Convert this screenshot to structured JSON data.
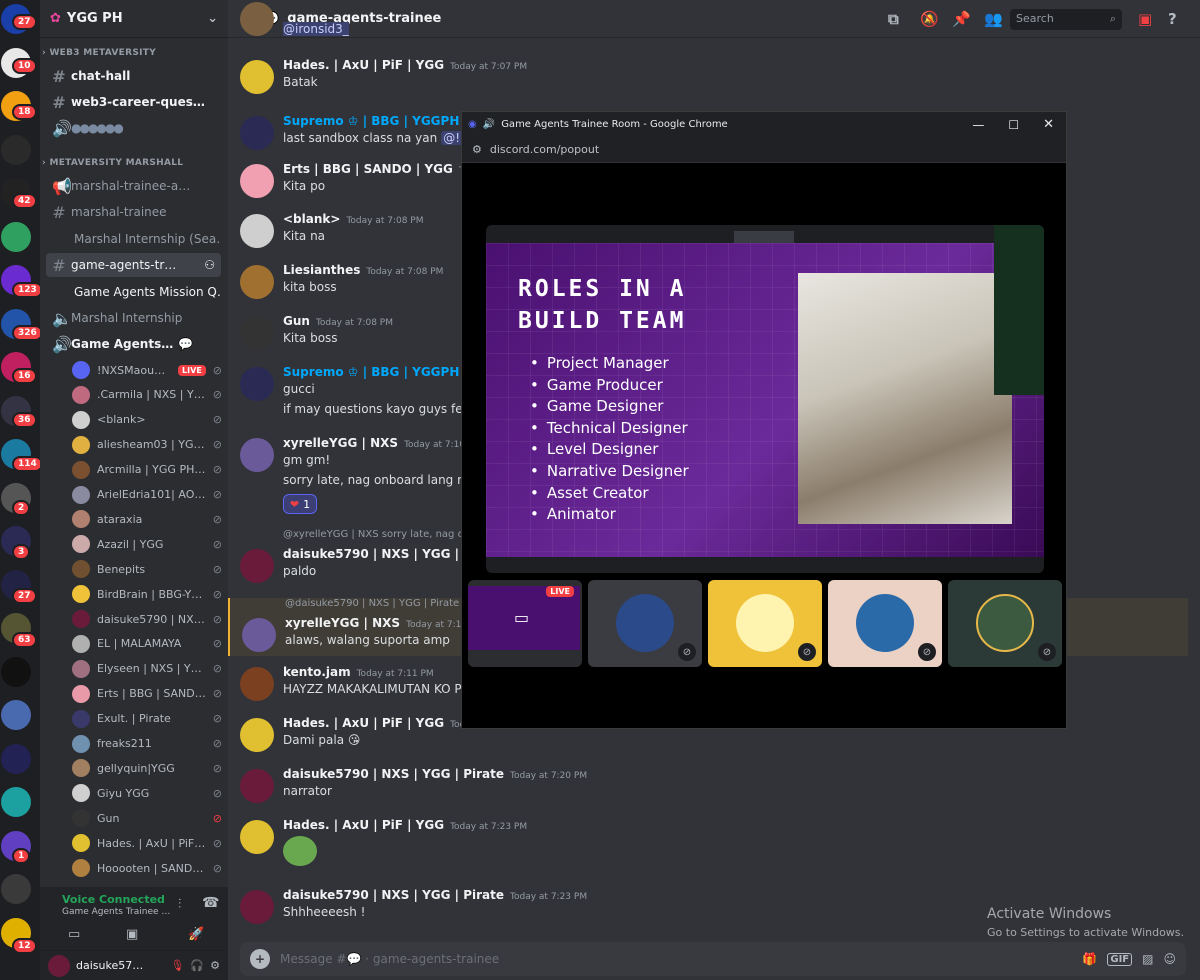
{
  "guild_badges": [
    "27",
    "10",
    "18",
    "42",
    "123",
    "326",
    "16",
    "36",
    "114",
    "2",
    "3",
    "27",
    "63",
    "1",
    "12"
  ],
  "server": {
    "name": "YGG PH"
  },
  "sidebar": {
    "cat1": "WEB3 METAVERSITY",
    "cat2": "METAVERSITY MARSHALL",
    "channels": [
      "chat-hall",
      "web3-career-ques…",
      "marshal-trainee-a…",
      "marshal-trainee",
      "Marshal Internship (Sea…",
      "game-agents-tr…",
      "Game Agents Mission Q…",
      "Marshal Internship",
      "Game Agents…"
    ],
    "voice_users": [
      "!NXSMaouY…",
      ".Carmila | NXS | YGG",
      "<blank>",
      "aliesheam03 | YGG …",
      "Arcmilla | YGG PH …",
      "ArielEdria101| AOF |…",
      "ataraxia",
      "Azazil | YGG",
      "Benepits",
      "BirdBrain | BBG-YGG",
      "daisuke5790 | NXS …",
      "EL | MALAMAYA",
      "Elyseen | NXS | YGG",
      "Erts | BBG | SANDO…",
      "Exult. | Pirate",
      "freaks211",
      "gellyquin|YGG",
      "Giyu YGG",
      "Gun",
      "Hades. | AxU | PiF |…",
      "Hooooten | SAND…"
    ],
    "live_label": "LIVE"
  },
  "voice": {
    "status": "Voice Connected",
    "channel": "Game Agents Trainee …"
  },
  "user": {
    "name": "daisuke57…"
  },
  "channel": {
    "name": "game-agents-trainee",
    "search_placeholder": "Search"
  },
  "messages": [
    {
      "author": "@ironsid3_",
      "time": "",
      "text": ""
    },
    {
      "author": "Hades. | AxU | PiF | YGG",
      "time": "Today at 7:07 PM",
      "text": "Batak"
    },
    {
      "author": "Supremo ♔ | BBG | YGGPH",
      "time": "",
      "text": "last sandbox class na yan",
      "mention": "@!NXS"
    },
    {
      "author": "Erts | BBG | SANDO | YGG",
      "time": "Toda",
      "text": "Kita po"
    },
    {
      "author": "<blank>",
      "time": "Today at 7:08 PM",
      "text": "Kita na"
    },
    {
      "author": "Liesianthes",
      "time": "Today at 7:08 PM",
      "text": "kita boss"
    },
    {
      "author": "Gun",
      "time": "Today at 7:08 PM",
      "text": "Kita boss"
    },
    {
      "author": "Supremo ♔ | BBG | YGGPH",
      "time": "Toda",
      "text": "gucci",
      "text2": "if may questions kayo guys feel fre"
    },
    {
      "author": "xyrelleYGG | NXS",
      "time": "Today at 7:10 PM",
      "text": "gm gm!",
      "text2": "sorry late, nag onboard lang ng pe",
      "reaction": "1"
    },
    {
      "author": "daisuke5790 | NXS | YGG | Pirate",
      "time": "",
      "text": "paldo",
      "reply": "@xyrelleYGG | NXS sorry late, nag o"
    },
    {
      "author": "xyrelleYGG | NXS",
      "time": "Today at 7:10 PM",
      "text": "alaws, walang suporta amp",
      "reply": "@daisuke5790 | NXS | YGG | Pirate"
    },
    {
      "author": "kento.jam",
      "time": "Today at 7:11 PM",
      "text": "HAYZZ MAKAKALIMUTAN KO PA"
    },
    {
      "author": "Hades. | AxU | PiF | YGG",
      "time": "Today at",
      "text": "Dami pala 😘"
    },
    {
      "author": "daisuke5790 | NXS | YGG | Pirate",
      "time": "Today at 7:20 PM",
      "text": "narrator"
    },
    {
      "author": "Hades. | AxU | PiF | YGG",
      "time": "Today at 7:23 PM",
      "text": ""
    },
    {
      "author": "daisuke5790 | NXS | YGG | Pirate",
      "time": "Today at 7:23 PM",
      "text": "Shhheeeesh !"
    }
  ],
  "composer": {
    "placeholder": "Message #💬 · game-agents-trainee"
  },
  "popup": {
    "window_title": "Game Agents Trainee Room - Google Chrome",
    "url": "discord.com/popout",
    "slide_title_1": "ROLES IN A",
    "slide_title_2": "BUILD TEAM",
    "roles": [
      "Project Manager",
      "Game Producer",
      "Game Designer",
      "Technical Designer",
      "Level Designer",
      "Narrative Designer",
      "Asset Creator",
      "Animator"
    ],
    "live_label": "LIVE"
  },
  "watermark": {
    "line1": "Activate Windows",
    "line2": "Go to Settings to activate Windows."
  }
}
